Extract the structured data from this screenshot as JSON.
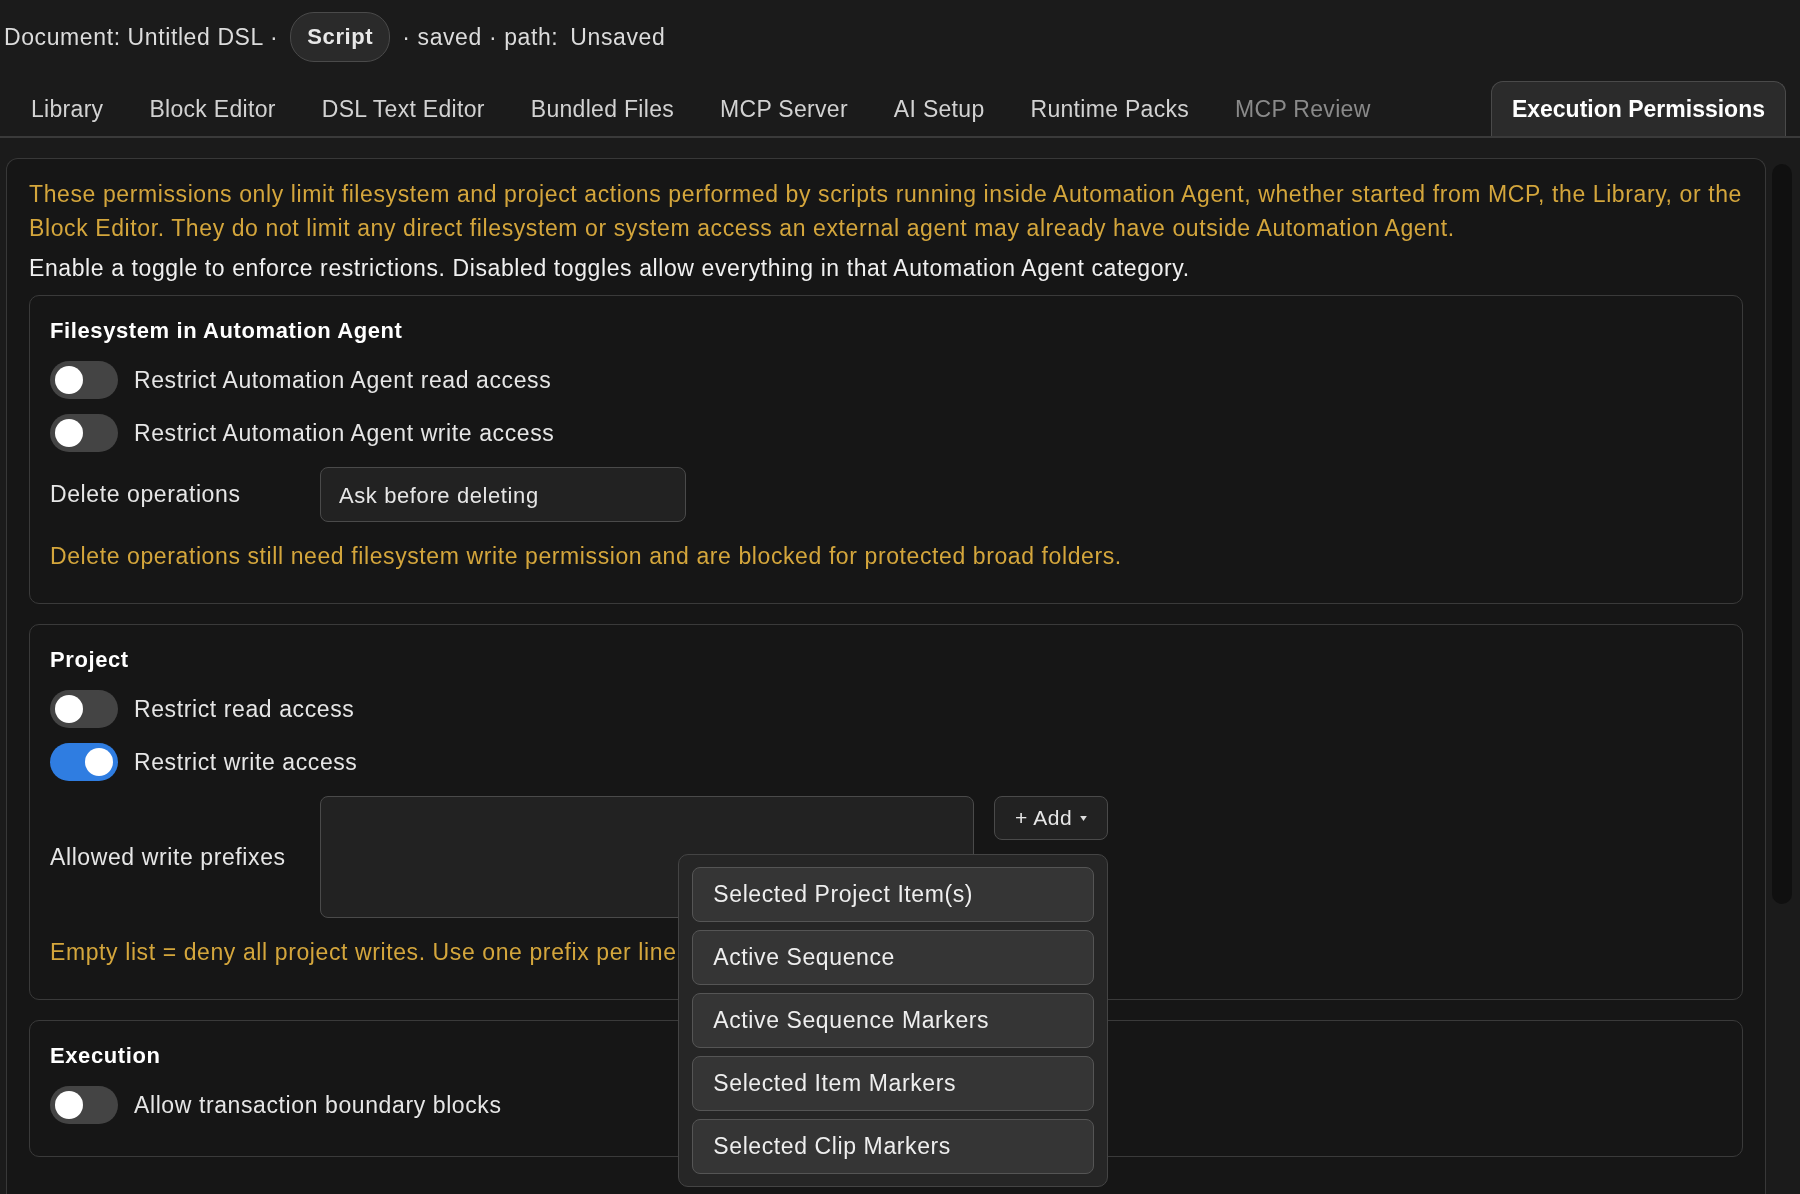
{
  "document": {
    "label": "Document: Untitled DSL ·",
    "type_chip": "Script",
    "status": "· saved · path:",
    "path": "Unsaved"
  },
  "tabs": [
    {
      "label": "Library",
      "selected": false,
      "disabled": false
    },
    {
      "label": "Block Editor",
      "selected": false,
      "disabled": false
    },
    {
      "label": "DSL Text Editor",
      "selected": false,
      "disabled": false
    },
    {
      "label": "Bundled Files",
      "selected": false,
      "disabled": false
    },
    {
      "label": "MCP Server",
      "selected": false,
      "disabled": false
    },
    {
      "label": "AI Setup",
      "selected": false,
      "disabled": false
    },
    {
      "label": "Runtime Packs",
      "selected": false,
      "disabled": false
    },
    {
      "label": "MCP Review",
      "selected": false,
      "disabled": true
    },
    {
      "label": "Execution Permissions",
      "selected": true,
      "disabled": false
    }
  ],
  "notice": "These permissions only limit filesystem and project actions performed by scripts running inside Automation Agent, whether started from MCP, the Library, or the Block Editor. They do not limit any direct filesystem or system access an external agent may already have outside Automation Agent.",
  "hint": "Enable a toggle to enforce restrictions. Disabled toggles allow everything in that Automation Agent category.",
  "sections": [
    {
      "title": "Filesystem in Automation Agent",
      "rows": [
        {
          "kind": "toggle",
          "label": "Restrict Automation Agent read access",
          "on": false
        },
        {
          "kind": "toggle",
          "label": "Restrict Automation Agent write access",
          "on": false
        },
        {
          "kind": "select",
          "label": "Delete operations",
          "value": "Ask before deleting"
        },
        {
          "kind": "note",
          "text": "Delete operations still need filesystem write permission and are blocked for protected broad folders."
        }
      ]
    },
    {
      "title": "Project",
      "rows": [
        {
          "kind": "toggle",
          "label": "Restrict read access",
          "on": false
        },
        {
          "kind": "toggle",
          "label": "Restrict write access",
          "on": true
        },
        {
          "kind": "prefixes",
          "label": "Allowed write prefixes",
          "add_button": "+ Add",
          "menu": {
            "expanded": true,
            "items": [
              "Selected Project Item(s)",
              "Active Sequence",
              "Active Sequence Markers",
              "Selected Item Markers",
              "Selected Clip Markers"
            ]
          }
        },
        {
          "kind": "note",
          "text": "Empty list = deny all project writes. Use one prefix per line"
        }
      ]
    },
    {
      "title": "Execution",
      "rows": [
        {
          "kind": "toggle",
          "label": "Allow transaction boundary blocks",
          "on": false
        }
      ]
    }
  ]
}
